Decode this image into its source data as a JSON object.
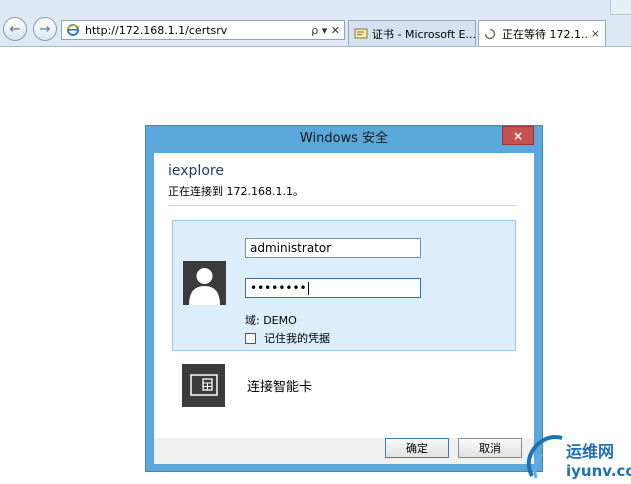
{
  "browser": {
    "address": {
      "url": "http://172.168.1.1/certsrv",
      "controls": "ρ ▾ ✕"
    },
    "tabs": [
      {
        "label": "证书 - Microsoft E...",
        "active": false
      },
      {
        "label": "正在等待 172.1...",
        "active": true
      }
    ],
    "tab_close_glyph": "×"
  },
  "dialog": {
    "title": "Windows 安全",
    "close_glyph": "×",
    "app_name": "iexplore",
    "connecting_message": "正在连接到 172.168.1.1。",
    "credentials": {
      "username_value": "administrator",
      "password_mask": "••••••••",
      "domain_text": "域: DEMO",
      "remember_label": "记住我的凭据",
      "remember_checked": false
    },
    "smartcard_label": "连接智能卡",
    "ok_label": "确定",
    "cancel_label": "取消"
  },
  "watermark": {
    "cn": "运维网",
    "en": "iyunv.com"
  },
  "colors": {
    "dialog_frame": "#5aa7d9",
    "close_button": "#c75050",
    "credential_panel": "#dceefb",
    "tile": "#3b3b3b"
  }
}
